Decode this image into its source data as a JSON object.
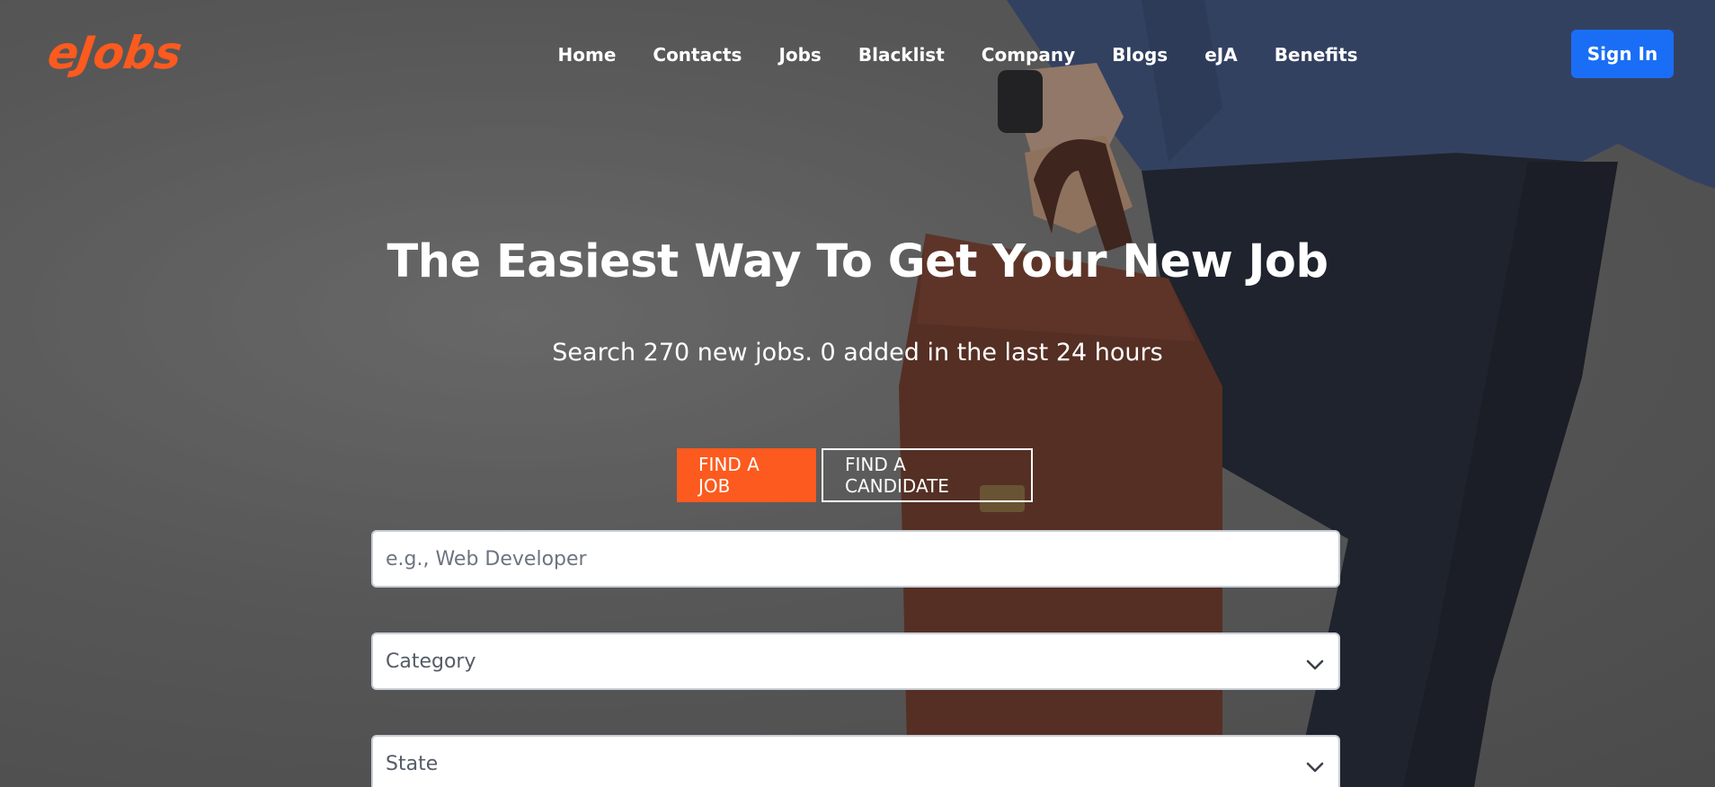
{
  "brand": {
    "logo_text": "eJobs",
    "accent": "#fc5a1e",
    "primary": "#1a6ef5"
  },
  "nav": {
    "items": [
      "Home",
      "Contacts",
      "Jobs",
      "Blacklist",
      "Company",
      "Blogs",
      "eJA",
      "Benefits"
    ],
    "signin_label": "Sign In"
  },
  "hero": {
    "title": "The Easiest Way To Get Your New Job",
    "subtitle": "Search 270 new jobs. 0 added in the last 24 hours",
    "tabs": [
      {
        "label": "FIND A JOB",
        "active": true
      },
      {
        "label": "FIND A CANDIDATE",
        "active": false
      }
    ]
  },
  "search": {
    "keyword_placeholder": "e.g., Web Developer",
    "category_value": "Category",
    "state_value": "State"
  },
  "icons": {
    "dropdown": "chevron-down-icon"
  }
}
